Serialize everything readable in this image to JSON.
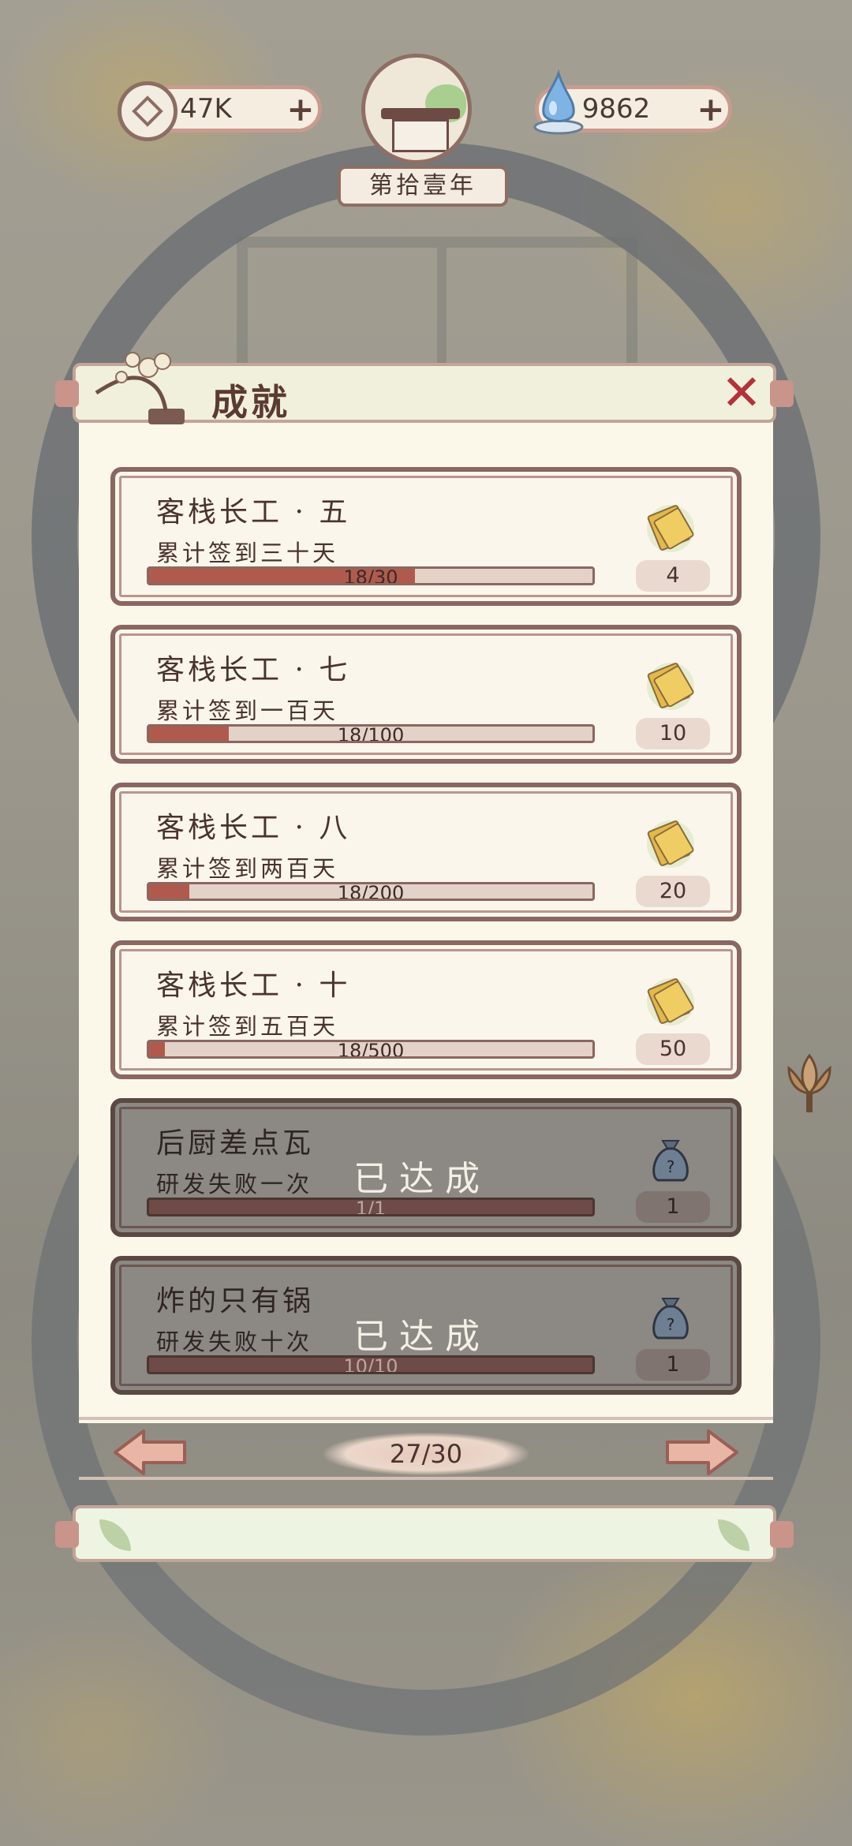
{
  "hud": {
    "coins": "47K",
    "drops": "9862",
    "year": "第拾壹年"
  },
  "panel": {
    "title": "成就",
    "page": "27/30"
  },
  "achievements": [
    {
      "name": "客栈长工 · 五",
      "desc": "累计签到三十天",
      "progress": "18/30",
      "ratio": 0.6,
      "reward_icon": "ticket-icon",
      "reward": "4",
      "done": false
    },
    {
      "name": "客栈长工 · 七",
      "desc": "累计签到一百天",
      "progress": "18/100",
      "ratio": 0.18,
      "reward_icon": "ticket-icon",
      "reward": "10",
      "done": false
    },
    {
      "name": "客栈长工 · 八",
      "desc": "累计签到两百天",
      "progress": "18/200",
      "ratio": 0.09,
      "reward_icon": "ticket-icon",
      "reward": "20",
      "done": false
    },
    {
      "name": "客栈长工 · 十",
      "desc": "累计签到五百天",
      "progress": "18/500",
      "ratio": 0.036,
      "reward_icon": "ticket-icon",
      "reward": "50",
      "done": false
    },
    {
      "name": "后厨差点瓦",
      "desc": "研发失败一次",
      "progress": "1/1",
      "ratio": 1,
      "reward_icon": "mystery-bag-icon",
      "reward": "1",
      "done": true,
      "status": "已达成"
    },
    {
      "name": "炸的只有锅",
      "desc": "研发失败十次",
      "progress": "10/10",
      "ratio": 1,
      "reward_icon": "mystery-bag-icon",
      "reward": "1",
      "done": true,
      "status": "已达成"
    }
  ],
  "colors": {
    "accent": "#b05a4e",
    "border": "#8a6760",
    "panel_bg": "#fbf8ea",
    "close": "#b3333a"
  }
}
